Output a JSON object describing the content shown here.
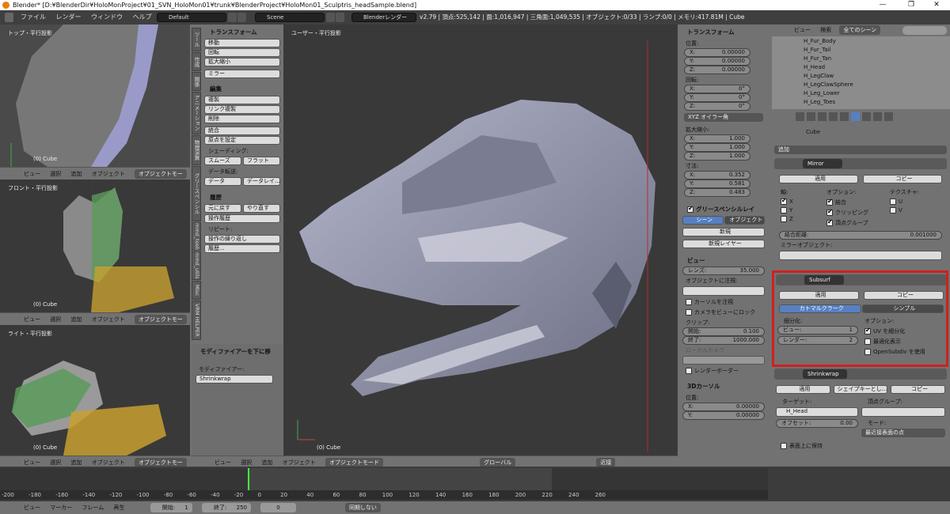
{
  "window": {
    "title": "Blender* [D:¥BlenderDir¥HoloMonProject¥01_SVN_HoloMon01¥trunk¥BlenderProject¥HoloMon01_Sculptris_headSample.blend]",
    "minimize": "—",
    "maximize": "❐",
    "close": "✕"
  },
  "topbar": {
    "menus": [
      "ファイル",
      "レンダー",
      "ウィンドウ",
      "ヘルプ"
    ],
    "layout": "Default",
    "scene": "Scene",
    "engine": "Blenderレンダー",
    "stats": "v2.79 | 頂点:525,142 | 面:1,016,947 | 三角面:1,049,535 | オブジェクト:0/33 | ランプ:0/0 | メモリ:417.81M | Cube"
  },
  "viewports": {
    "top": {
      "label": "トップ・平行投影",
      "obj": "(0) Cube"
    },
    "front": {
      "label": "フロント・平行投影",
      "obj": "(0) Cube"
    },
    "right": {
      "label": "ライト・平行投影",
      "obj": "(0) Cube"
    },
    "main": {
      "label": "ユーザー・平行投影",
      "obj": "(0) Cube"
    }
  },
  "vpheader": {
    "view": "ビュー",
    "select": "選択",
    "add": "追加",
    "object": "オブジェクト",
    "mode": "オブジェクトモー",
    "mode_full": "オブジェクトモード",
    "global": "グローバル",
    "near": "近接"
  },
  "toolshelf": {
    "transform": "トランスフォーム",
    "move": "移動",
    "rotate": "回転",
    "scale": "拡大縮小",
    "mirror": "ミラー",
    "edit": "編集",
    "duplicate": "複製",
    "link_dup": "リンク複製",
    "delete": "削除",
    "join": "統合",
    "origin": "原点を設定",
    "shading": "シェーディング:",
    "smooth": "スムーズ",
    "flat": "フラット",
    "data_transfer": "データ転送:",
    "data": "データ",
    "data_layout": "データレイ...",
    "history": "履歴",
    "undo": "元に戻す",
    "redo": "やり直す",
    "undo_history": "操作履歴",
    "repeat": "リピート:",
    "repeat_last": "操作の繰り返し",
    "history_btn": "履歴...",
    "tabs": [
      "ツール",
      "作成",
      "関係",
      "アニメーション",
      "物理演算",
      "グリースペンシル",
      "mmd_tools",
      "mmd_utils",
      "Misc",
      "VRM HELPER"
    ],
    "mod_down": "モディファイアーを下に移",
    "modifier_label": "モディファイアー:",
    "modifier_value": "Shrinkwrap"
  },
  "npanel": {
    "transform": "トランスフォーム",
    "location": "位置:",
    "loc": [
      "0.00000",
      "0.00000",
      "0.00000"
    ],
    "rotation": "回転:",
    "rot": [
      "0°",
      "0°",
      "0°"
    ],
    "euler": "XYZ オイラー角",
    "scale": "拡大縮小:",
    "scl": [
      "1.000",
      "1.000",
      "1.000"
    ],
    "dims": "寸法:",
    "dim": [
      "0.352",
      "0.581",
      "0.483"
    ],
    "axes": [
      "X:",
      "Y:",
      "Z:"
    ],
    "grease": "グリースペンシルレイ",
    "scene_tab": "シーン",
    "object_tab": "オブジェクト",
    "new": "新規",
    "new_layer": "新規レイヤー",
    "view": "ビュー",
    "lens_label": "レンズ:",
    "lens": "35.000",
    "lock_obj": "オブジェクトに注視:",
    "lock_cursor": "カーソルを注視",
    "lock_camera": "カメラをビューにロック",
    "clip": "クリップ:",
    "clip_start_label": "開始:",
    "clip_start": "0.100",
    "clip_end_label": "終了:",
    "clip_end": "1000.000",
    "local_cam": "ローカルカメラ",
    "render_border": "レンダーボーダー",
    "cursor": "3Dカーソル",
    "cursor_loc": "位置:",
    "cur": [
      "0.00000",
      "0.00000"
    ]
  },
  "outliner": {
    "view": "ビュー",
    "search": "検索",
    "filter": "全てのシーン",
    "items": [
      "H_Fur_Body",
      "H_Fur_Tail",
      "H_Fur_Tan",
      "H_Head",
      "H_LegClaw",
      "H_LegClawSphere",
      "H_Leg_Lower",
      "H_Leg_Toes"
    ]
  },
  "props": {
    "object": "Cube",
    "add": "追加",
    "mirror": {
      "name": "Mirror",
      "apply": "適用",
      "copy": "コピー",
      "axis": "軸:",
      "options": "オプション:",
      "texture": "テクスチャ:",
      "x": "X",
      "y": "Y",
      "z": "Z",
      "merge": "結合",
      "clipping": "クリッピング",
      "vgroup": "頂点グループ",
      "u": "U",
      "v": "V",
      "merge_dist_label": "結合距離:",
      "merge_dist": "0.001000",
      "mirror_obj": "ミラーオブジェクト:"
    },
    "subsurf": {
      "name": "Subsurf",
      "apply": "適用",
      "copy": "コピー",
      "catmull": "カトマルクラーク",
      "simple": "シンプル",
      "subdiv": "細分化:",
      "options": "オプション:",
      "view_label": "ビュー:",
      "view": "1",
      "render_label": "レンダー:",
      "render": "2",
      "uv": "UV を細分化",
      "optimal": "最適化表示",
      "opensubdiv": "OpenSubdiv を使用"
    },
    "shrink": {
      "name": "Shrinkwrap",
      "apply": "適用",
      "shapekey": "シェイプキーとし...",
      "copy": "コピー",
      "target_label": "ターゲット:",
      "target": "H_Head",
      "vgroup_label": "頂点グループ:",
      "offset_label": "オフセット:",
      "offset": "0.00",
      "mode_label": "モード:",
      "mode": "最近接表面の点",
      "keep": "表面上に保持"
    }
  },
  "timeline": {
    "ticks": [
      "-200",
      "-180",
      "-160",
      "-140",
      "-120",
      "-100",
      "-80",
      "-60",
      "-40",
      "-20",
      "0",
      "20",
      "40",
      "60",
      "80",
      "100",
      "120",
      "140",
      "160",
      "180",
      "200",
      "220",
      "240",
      "260"
    ],
    "view": "ビュー",
    "marker": "マーカー",
    "frame": "フレーム",
    "play": "再生",
    "start_label": "開始:",
    "start": "1",
    "end_label": "終了:",
    "end": "250",
    "current": "0",
    "sync": "同期しない"
  }
}
